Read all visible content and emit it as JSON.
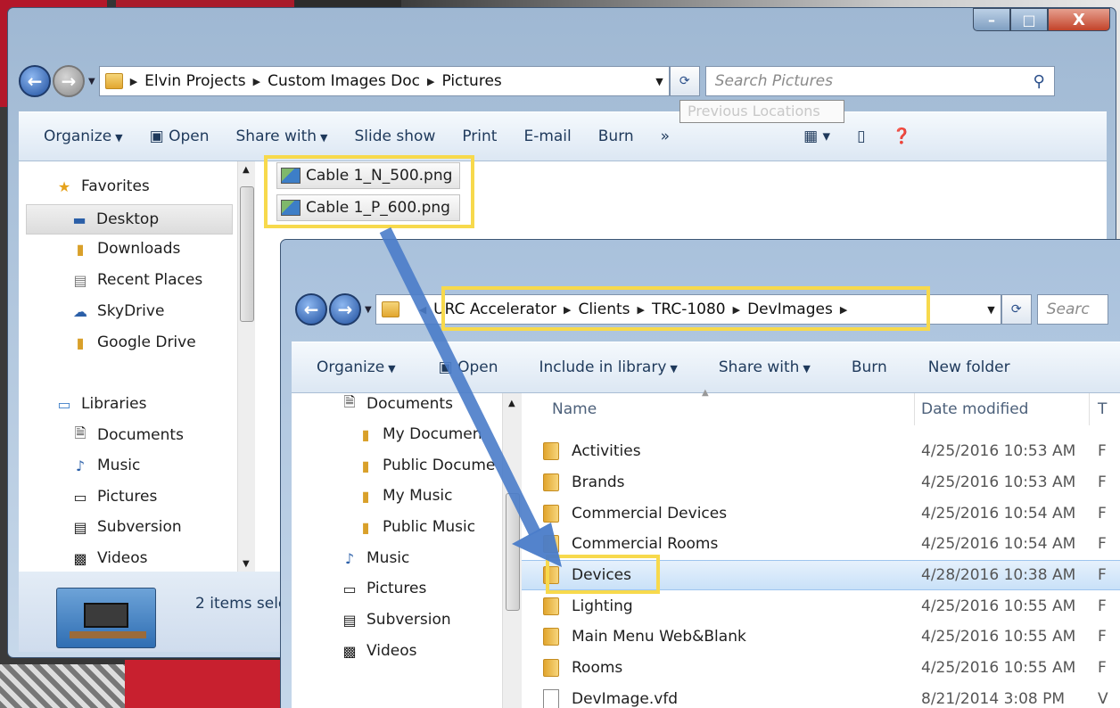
{
  "window1": {
    "caption_buttons": {
      "minimize": "–",
      "maximize": "□",
      "close": "X"
    },
    "breadcrumb": [
      "Elvin Projects",
      "Custom Images Doc",
      "Pictures"
    ],
    "search_placeholder": "Search Pictures",
    "toolbar": [
      "Organize",
      "Open",
      "Share with",
      "Slide show",
      "Print",
      "E-mail",
      "Burn",
      "»"
    ],
    "tooltip": "Previous Locations",
    "nav": {
      "favorites_header": "Favorites",
      "favorites": [
        "Desktop",
        "Downloads",
        "Recent Places",
        "SkyDrive",
        "Google Drive"
      ],
      "libraries_header": "Libraries",
      "libraries": [
        "Documents",
        "Music",
        "Pictures",
        "Subversion",
        "Videos"
      ]
    },
    "files": [
      "Cable 1_N_500.png",
      "Cable 1_P_600.png"
    ],
    "status": "2 items sele"
  },
  "window2": {
    "breadcrumb": [
      "URC Accelerator",
      "Clients",
      "TRC-1080",
      "DevImages"
    ],
    "search_placeholder": "Searc",
    "toolbar": [
      "Organize",
      "Open",
      "Include in library",
      "Share with",
      "Burn",
      "New folder"
    ],
    "nav": [
      "Documents",
      "My Documen",
      "Public Docume",
      "My Music",
      "Public Music",
      "Music",
      "Pictures",
      "Subversion",
      "Videos"
    ],
    "columns": {
      "name": "Name",
      "date": "Date modified",
      "type": "T"
    },
    "rows": [
      {
        "name": "Activities",
        "date": "4/25/2016 10:53 AM",
        "type": "F"
      },
      {
        "name": "Brands",
        "date": "4/25/2016 10:53 AM",
        "type": "F"
      },
      {
        "name": "Commercial Devices",
        "date": "4/25/2016 10:54 AM",
        "type": "F"
      },
      {
        "name": "Commercial Rooms",
        "date": "4/25/2016 10:54 AM",
        "type": "F"
      },
      {
        "name": "Devices",
        "date": "4/28/2016 10:38 AM",
        "type": "F"
      },
      {
        "name": "Lighting",
        "date": "4/25/2016 10:55 AM",
        "type": "F"
      },
      {
        "name": "Main Menu Web&Blank",
        "date": "4/25/2016 10:55 AM",
        "type": "F"
      },
      {
        "name": "Rooms",
        "date": "4/25/2016 10:55 AM",
        "type": "F"
      },
      {
        "name": "DevImage.vfd",
        "date": "8/21/2014 3:08 PM",
        "type": "V"
      }
    ]
  }
}
